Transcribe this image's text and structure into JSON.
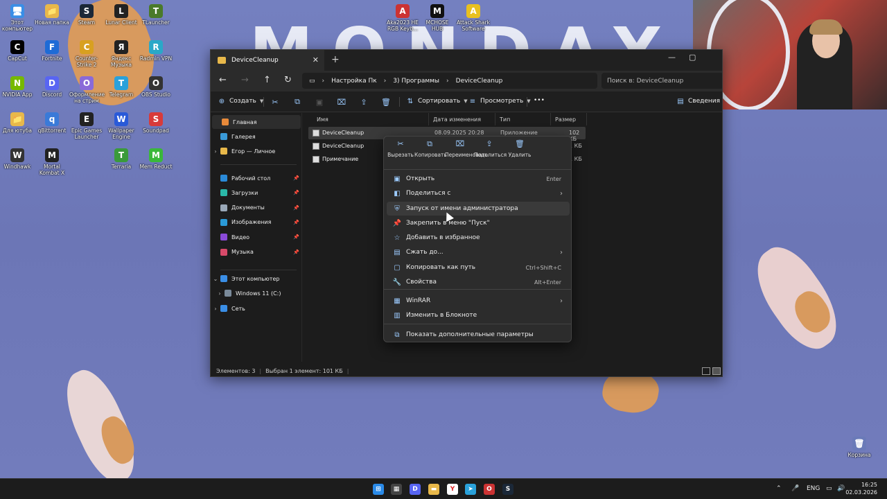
{
  "wallpaper": {
    "title": "MONDAY"
  },
  "desktop_icons": [
    {
      "id": "this-pc",
      "label": "Этот компьютер",
      "color": "#3a8ee6",
      "glyph": "🖥"
    },
    {
      "id": "new-folder",
      "label": "Новая папка",
      "color": "#e8b84a",
      "glyph": "📁"
    },
    {
      "id": "steam",
      "label": "Steam",
      "color": "#1b2838",
      "glyph": "S"
    },
    {
      "id": "lunar",
      "label": "Lunar Client",
      "color": "#222",
      "glyph": "L"
    },
    {
      "id": "tlauncher",
      "label": "TLauncher",
      "color": "#4a7a2a",
      "glyph": "T"
    },
    {
      "id": "aka",
      "label": "Aka2023 HE RGB Keyb...",
      "color": "#c33",
      "glyph": "A"
    },
    {
      "id": "mchose",
      "label": "MCHOSE HUB",
      "color": "#111",
      "glyph": "M"
    },
    {
      "id": "attackshark",
      "label": "Attack Shark Software",
      "color": "#e8c020",
      "glyph": "A"
    },
    {
      "id": "capcut",
      "label": "CapCut",
      "color": "#000",
      "glyph": "C"
    },
    {
      "id": "fortnite",
      "label": "Fortnite",
      "color": "#1e6bd6",
      "glyph": "F"
    },
    {
      "id": "cs",
      "label": "Counter-Strike 2",
      "color": "#d8a020",
      "glyph": "C"
    },
    {
      "id": "yamusic",
      "label": "Яндекс Музыка",
      "color": "#222",
      "glyph": "Я"
    },
    {
      "id": "radmin",
      "label": "Radmin VPN",
      "color": "#2aa8c8",
      "glyph": "R"
    },
    {
      "id": "nvidia",
      "label": "NVIDIA App",
      "color": "#76b900",
      "glyph": "N"
    },
    {
      "id": "discord",
      "label": "Discord",
      "color": "#5865f2",
      "glyph": "D"
    },
    {
      "id": "stream",
      "label": "Оформление на стрим",
      "color": "#8a6ad8",
      "glyph": "О"
    },
    {
      "id": "telegram",
      "label": "Telegram",
      "color": "#2aa1da",
      "glyph": "T"
    },
    {
      "id": "obs",
      "label": "OBS Studio",
      "color": "#333",
      "glyph": "O"
    },
    {
      "id": "youtube",
      "label": "Для ютуба",
      "color": "#e8b84a",
      "glyph": "📁"
    },
    {
      "id": "qbit",
      "label": "qBittorrent",
      "color": "#3a7ad8",
      "glyph": "q"
    },
    {
      "id": "epic",
      "label": "Epic Games Launcher",
      "color": "#222",
      "glyph": "E"
    },
    {
      "id": "wallpaper",
      "label": "Wallpaper Engine",
      "color": "#2a5ad8",
      "glyph": "W"
    },
    {
      "id": "soundpad",
      "label": "Soundpad",
      "color": "#d83a3a",
      "glyph": "S"
    },
    {
      "id": "windhawk",
      "label": "Windhawk",
      "color": "#333",
      "glyph": "W"
    },
    {
      "id": "mk",
      "label": "Mortal Kombat X",
      "color": "#222",
      "glyph": "M"
    },
    {
      "id": "terraria",
      "label": "Terraria",
      "color": "#3a9a3a",
      "glyph": "T"
    },
    {
      "id": "memreduct",
      "label": "Mem Reduct",
      "color": "#3ab83a",
      "glyph": "M"
    },
    {
      "id": "recycle",
      "label": "Корзина",
      "color": "#6a7ab8",
      "glyph": "🗑"
    }
  ],
  "explorer": {
    "tab_title": "DeviceCleanup",
    "breadcrumb": [
      "Настройка Пк",
      "3) Программы",
      "DeviceCleanup"
    ],
    "search_placeholder": "Поиск в: DeviceCleanup",
    "commands": {
      "create": "Создать",
      "sort": "Сортировать",
      "view": "Просмотреть",
      "more": "•••",
      "details": "Сведения"
    },
    "sidebar": {
      "home": "Главная",
      "gallery": "Галерея",
      "personal": "Егор — Личное",
      "pinned": [
        {
          "label": "Рабочий стол",
          "color": "#2a8ad8"
        },
        {
          "label": "Загрузки",
          "color": "#2ab8a8"
        },
        {
          "label": "Документы",
          "color": "#9aa8b8"
        },
        {
          "label": "Изображения",
          "color": "#2a9ad8"
        },
        {
          "label": "Видео",
          "color": "#8a4ad8"
        },
        {
          "label": "Музыка",
          "color": "#d84a6a"
        }
      ],
      "thispc": "Этот компьютер",
      "drive": "Windows 11 (C:)",
      "network": "Сеть"
    },
    "columns": [
      "Имя",
      "Дата изменения",
      "Тип",
      "Размер"
    ],
    "files": [
      {
        "name": "DeviceCleanup",
        "date": "08.09.2025 20:28",
        "type": "Приложение",
        "size": "102 КБ",
        "selected": true
      },
      {
        "name": "DeviceCleanup",
        "date": "",
        "type": "",
        "size": "1 КБ",
        "selected": false
      },
      {
        "name": "Примечание",
        "date": "",
        "type": "",
        "size": "1 КБ",
        "selected": false
      }
    ],
    "status": {
      "count": "Элементов: 3",
      "selection": "Выбран 1 элемент: 101 КБ"
    }
  },
  "context_menu": {
    "quick_actions": [
      "Вырезать",
      "Копировать",
      "Переименовать",
      "Поделиться",
      "Удалить"
    ],
    "items": [
      {
        "label": "Открыть",
        "shortcut": "Enter",
        "submenu": false,
        "icon": "▣"
      },
      {
        "label": "Поделиться с",
        "shortcut": "",
        "submenu": true,
        "icon": "◧"
      },
      {
        "label": "Запуск от имени администратора",
        "shortcut": "",
        "submenu": false,
        "icon": "⛨",
        "hover": true
      },
      {
        "label": "Закрепить в меню \"Пуск\"",
        "shortcut": "",
        "submenu": false,
        "icon": "📌"
      },
      {
        "label": "Добавить в избранное",
        "shortcut": "",
        "submenu": false,
        "icon": "☆"
      },
      {
        "label": "Сжать до...",
        "shortcut": "",
        "submenu": true,
        "icon": "▤"
      },
      {
        "label": "Копировать как путь",
        "shortcut": "Ctrl+Shift+C",
        "submenu": false,
        "icon": "▢"
      },
      {
        "label": "Свойства",
        "shortcut": "Alt+Enter",
        "submenu": false,
        "icon": "🔧"
      },
      {
        "label": "WinRAR",
        "shortcut": "",
        "submenu": true,
        "icon": "▦"
      },
      {
        "label": "Изменить в Блокноте",
        "shortcut": "",
        "submenu": false,
        "icon": "▥"
      },
      {
        "label": "Показать дополнительные параметры",
        "shortcut": "",
        "submenu": false,
        "icon": "⧉"
      }
    ]
  },
  "taskbar": {
    "lang": "ENG",
    "time": "16:25",
    "date": "02.03.2026"
  }
}
